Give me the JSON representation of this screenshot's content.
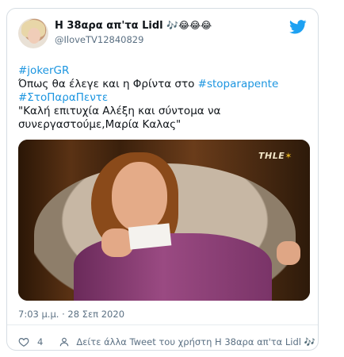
{
  "tweet": {
    "author_name": "Η 38αρα απ'τα Lidl",
    "author_emoji": "🎶😂😂😂",
    "handle": "@IloveTV12840829",
    "text_lines": [
      {
        "parts": [
          {
            "t": "#jokerGR",
            "tag": true
          }
        ]
      },
      {
        "parts": [
          {
            "t": "Όπως θα έλεγε και η Φρίντα στο ",
            "tag": false
          },
          {
            "t": "#stoparapente",
            "tag": true
          }
        ]
      },
      {
        "parts": [
          {
            "t": "#ΣτοΠαραΠεντε",
            "tag": true
          }
        ]
      },
      {
        "parts": [
          {
            "t": "\"Καλή επιτυχία Αλέξη και σύντομα να",
            "tag": false
          }
        ]
      },
      {
        "parts": [
          {
            "t": "συνεργαστούμε,Μαρία Καλας\"",
            "tag": false
          }
        ]
      }
    ],
    "media_watermark": "THLE",
    "timestamp": "7:03 μ.μ. · 28 Σεπ 2020",
    "like_count": "4",
    "more_tweets_label": "Δείτε άλλα Tweet του χρήστη Η 38αρα απ'τα Lidl 🎶"
  },
  "colors": {
    "link": "#1b95e0",
    "secondary_text": "#5b7083",
    "border": "#d6dde3"
  },
  "icons": [
    "twitter-bird-icon",
    "heart-icon",
    "person-icon"
  ]
}
